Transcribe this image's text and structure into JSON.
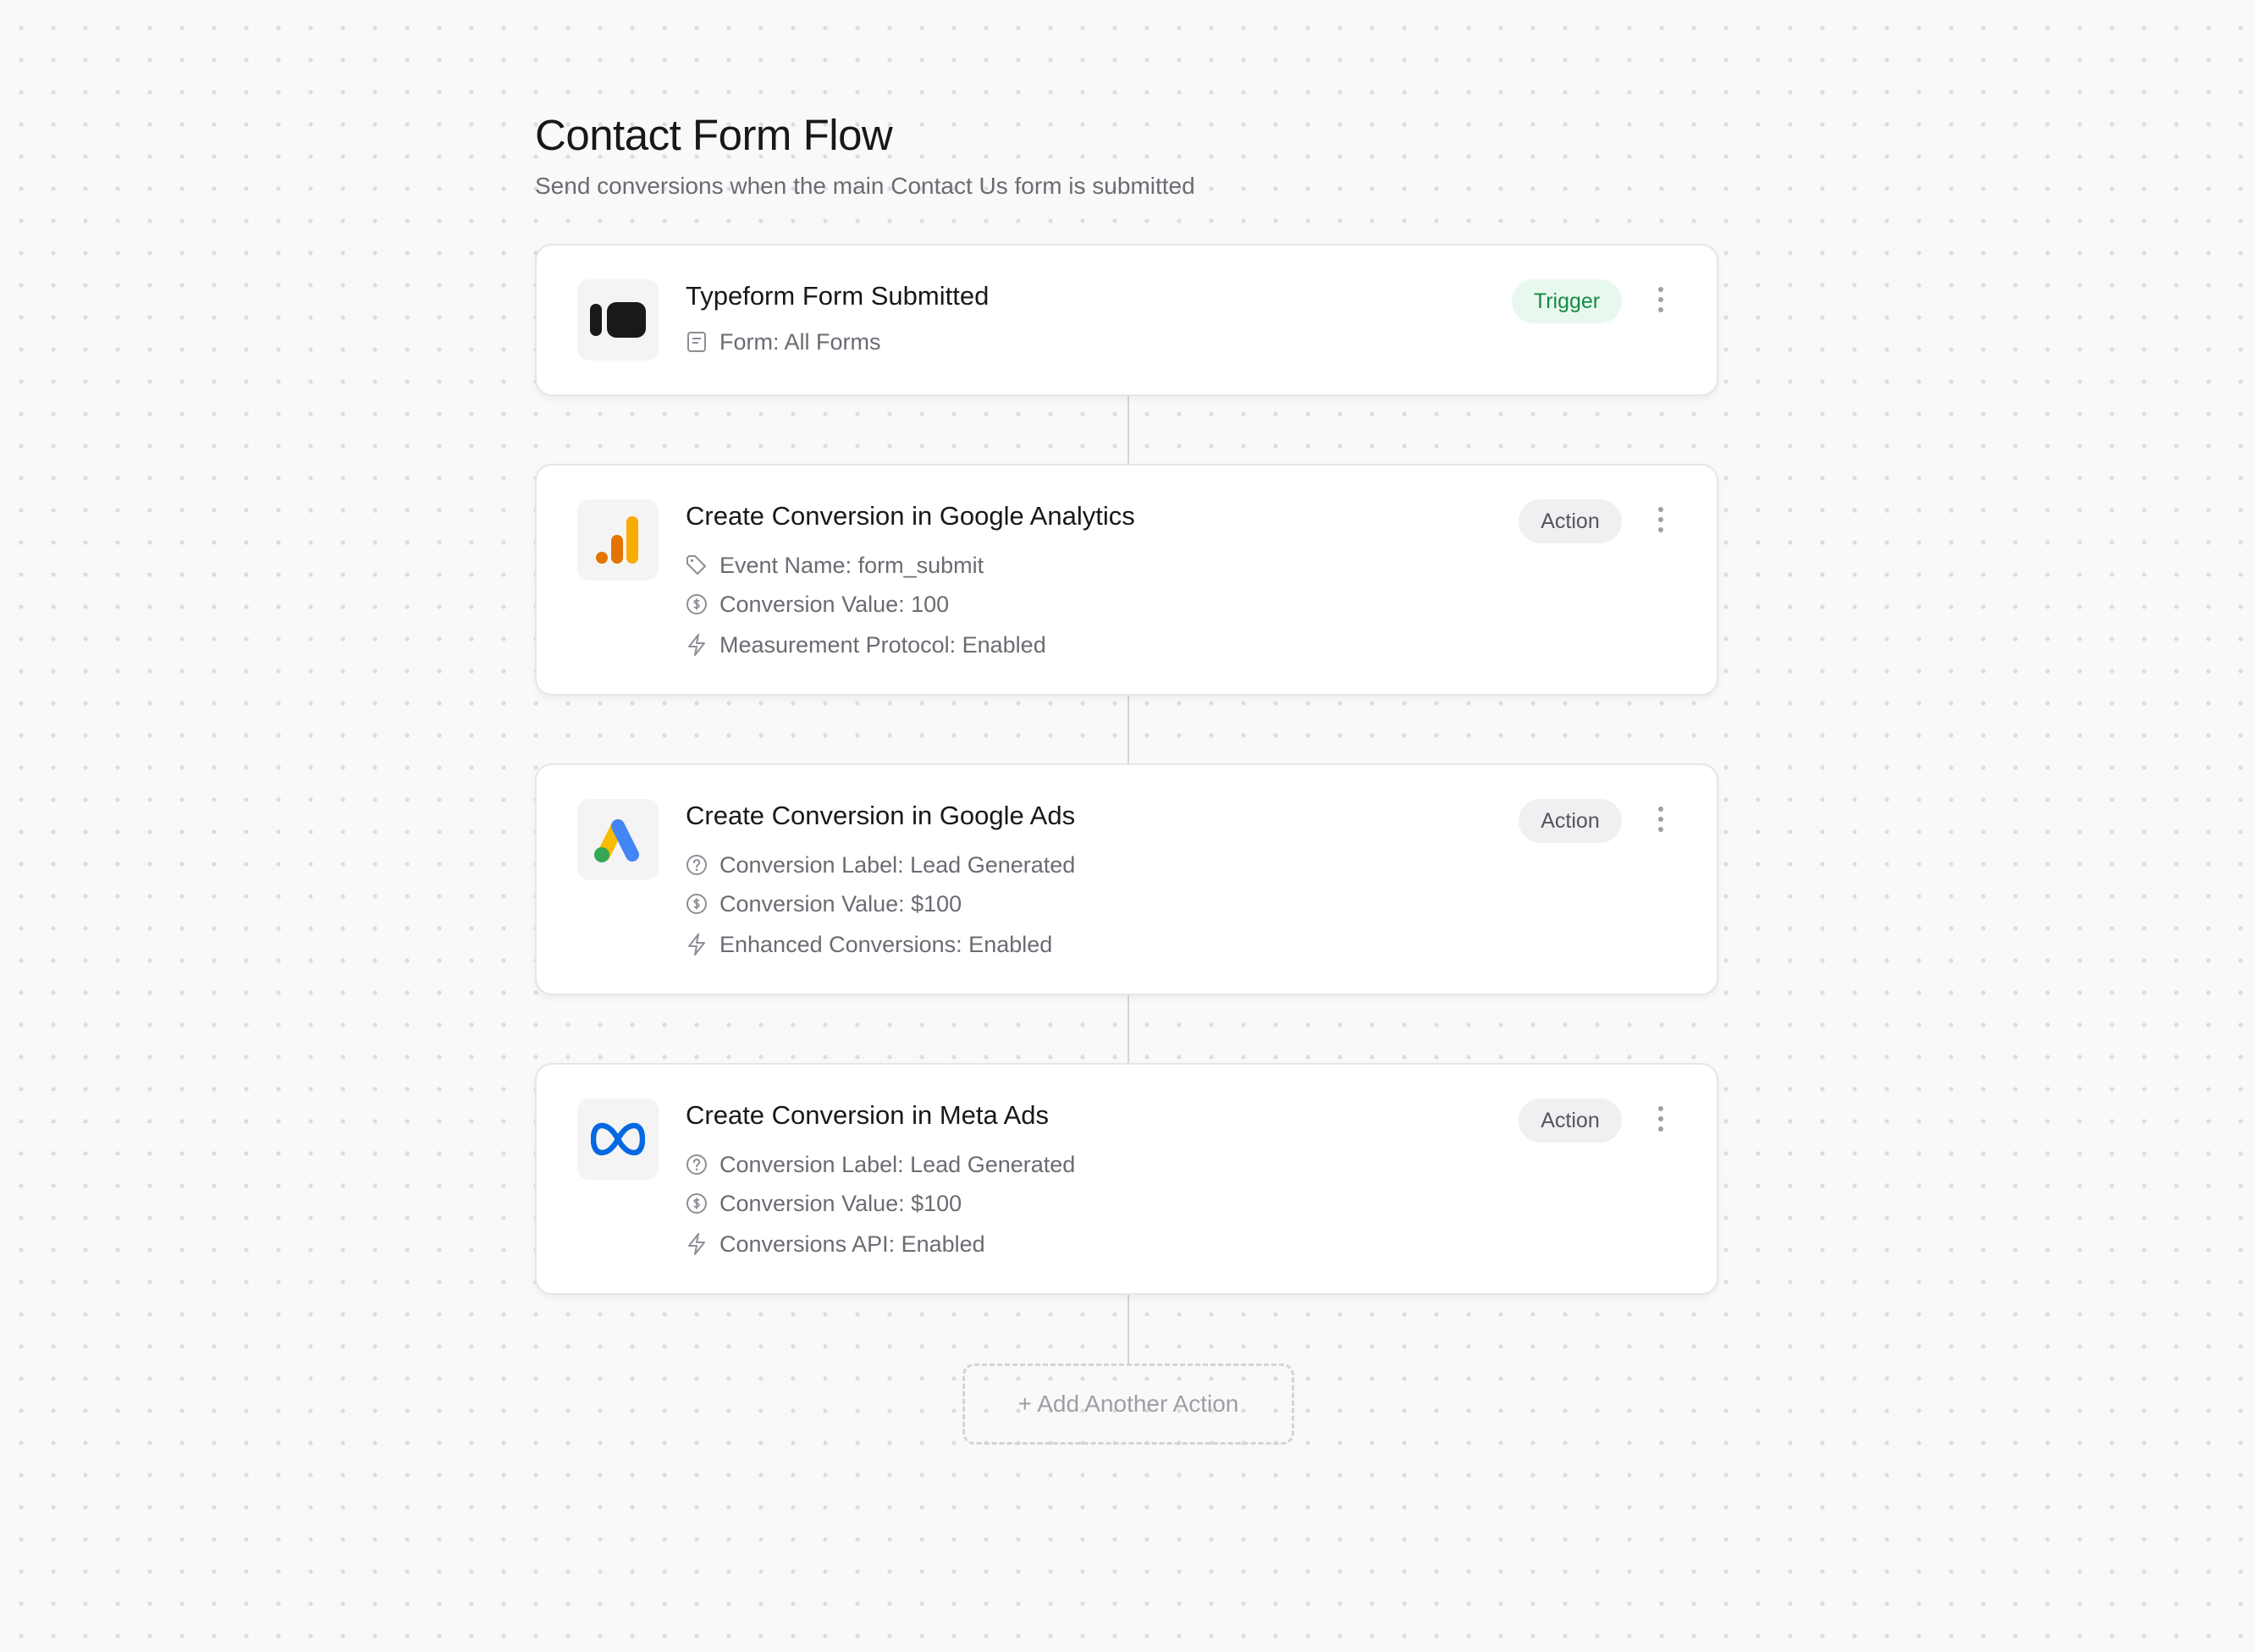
{
  "flow": {
    "title": "Contact Form Flow",
    "subtitle": "Send conversions when the main Contact Us form is submitted"
  },
  "steps": [
    {
      "app": "Typeform",
      "icon": "typeform-logo-icon",
      "title": "Typeform Form Submitted",
      "badge": "Trigger",
      "details": [
        {
          "icon": "form-document-icon",
          "text": "Form: All Forms"
        }
      ]
    },
    {
      "app": "Google Analytics",
      "icon": "google-analytics-logo-icon",
      "title": "Create Conversion in Google Analytics",
      "badge": "Action",
      "details": [
        {
          "icon": "tag-icon",
          "text": "Event Name: form_submit"
        },
        {
          "icon": "dollar-circle-icon",
          "text": "Conversion Value: 100"
        },
        {
          "icon": "lightning-icon",
          "text": "Measurement Protocol: Enabled"
        }
      ]
    },
    {
      "app": "Google Ads",
      "icon": "google-ads-logo-icon",
      "title": "Create Conversion in Google Ads",
      "badge": "Action",
      "details": [
        {
          "icon": "help-circle-icon",
          "text": "Conversion Label: Lead Generated"
        },
        {
          "icon": "dollar-circle-icon",
          "text": "Conversion Value: $100"
        },
        {
          "icon": "lightning-icon",
          "text": "Enhanced Conversions: Enabled"
        }
      ]
    },
    {
      "app": "Meta Ads",
      "icon": "meta-logo-icon",
      "title": "Create Conversion in Meta Ads",
      "badge": "Action",
      "details": [
        {
          "icon": "help-circle-icon",
          "text": "Conversion Label: Lead Generated"
        },
        {
          "icon": "dollar-circle-icon",
          "text": "Conversion Value: $100"
        },
        {
          "icon": "lightning-icon",
          "text": "Conversions API: Enabled"
        }
      ]
    }
  ],
  "add_action_label": "+ Add Another Action",
  "colors": {
    "trigger_badge_bg": "#e8f8ee",
    "trigger_badge_text": "#158a44",
    "action_badge_bg": "#f0f0f2",
    "action_badge_text": "#55555d",
    "ga_orange": "#e37400",
    "ga_yellow": "#f9ab00",
    "gads_blue": "#4285f4",
    "gads_yellow": "#fbbc04",
    "gads_green": "#34a853",
    "meta_blue": "#0668e1"
  }
}
